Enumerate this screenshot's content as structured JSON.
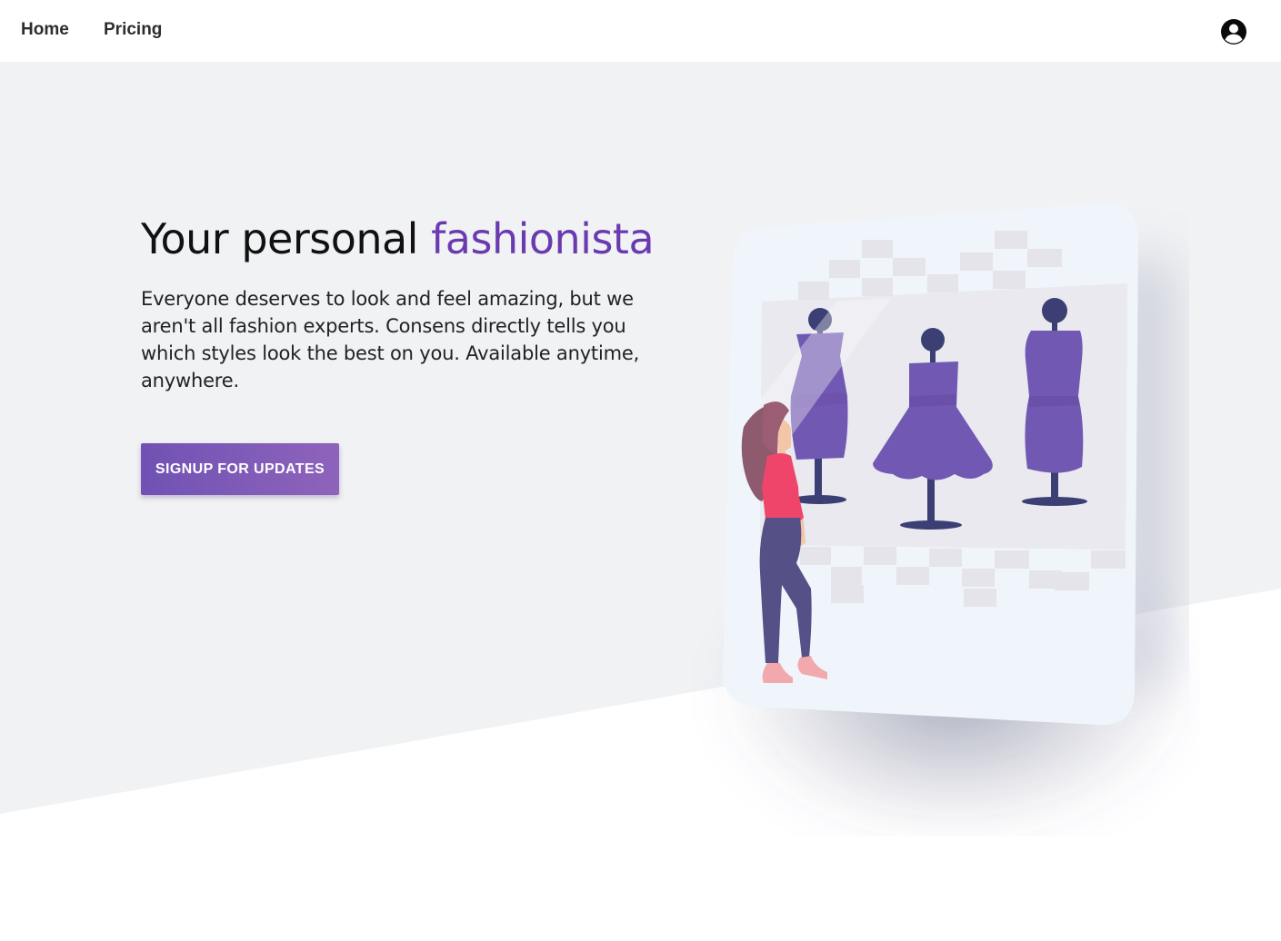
{
  "nav": {
    "home_label": "Home",
    "pricing_label": "Pricing",
    "account_icon": "account-circle-icon"
  },
  "hero": {
    "title_prefix": "Your personal ",
    "title_accent": "fashionista",
    "description": "Everyone deserves to look and feel amazing, but we aren't all fashion experts. Consens directly tells you which styles look the best on you. Available anytime, anywhere.",
    "cta_label": "SIGNUP FOR UPDATES"
  },
  "colors": {
    "accent": "#6a3bb0",
    "button_start": "#7052b4",
    "button_end": "#8e63bb",
    "hero_background": "#f1f2f4",
    "dress": "#7159b3",
    "mannequin_stand": "#3b3f74"
  }
}
